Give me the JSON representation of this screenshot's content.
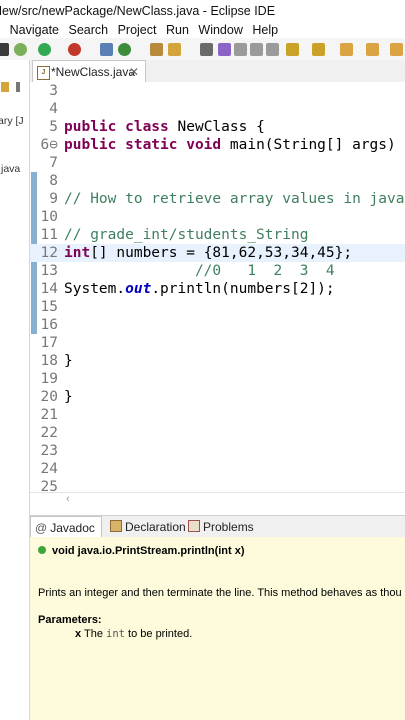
{
  "window": {
    "title": "New/src/newPackage/NewClass.java - Eclipse IDE"
  },
  "menu": {
    "items": [
      "r",
      "Navigate",
      "Search",
      "Project",
      "Run",
      "Window",
      "Help"
    ]
  },
  "left_panel": {
    "labels": [
      "ary [J",
      "java"
    ]
  },
  "editor": {
    "tab": {
      "label": "*NewClass.java",
      "icon": "J",
      "close": "✕"
    },
    "lines": [
      {
        "num": "3",
        "text": ""
      },
      {
        "num": "4",
        "text": ""
      },
      {
        "num": "5",
        "kw": "public class ",
        "text": "NewClass {"
      },
      {
        "num": "6⊖",
        "kw": "public static void ",
        "text": "main(String[] args) {"
      },
      {
        "num": "7",
        "text": ""
      },
      {
        "num": "8",
        "text": ""
      },
      {
        "num": "9",
        "comment": "// How to retrieve array values in java"
      },
      {
        "num": "10",
        "text": ""
      },
      {
        "num": "11",
        "comment": "// grade_int/students_String"
      },
      {
        "num": "12",
        "kw": "int",
        "text": "[] numbers = {81,62,53,34,45};"
      },
      {
        "num": "13",
        "comment": "               //0   1  2  3  4"
      },
      {
        "num": "14",
        "pre": "System.",
        "italic": "out",
        "post": ".println(numbers[2]);"
      },
      {
        "num": "15",
        "text": ""
      },
      {
        "num": "16",
        "text": ""
      },
      {
        "num": "17",
        "text": ""
      },
      {
        "num": "18",
        "text": "}"
      },
      {
        "num": "19",
        "text": ""
      },
      {
        "num": "20",
        "text": "}"
      },
      {
        "num": "21",
        "text": ""
      },
      {
        "num": "22",
        "text": ""
      },
      {
        "num": "23",
        "text": ""
      },
      {
        "num": "24",
        "text": ""
      },
      {
        "num": "25",
        "text": ""
      }
    ]
  },
  "bottom_panel": {
    "tabs": [
      "Javadoc",
      "Declaration",
      "Problems"
    ],
    "javadoc": {
      "signature": "void java.io.PrintStream.println(int x)",
      "description": "Prints an integer and then terminate the line. This method behaves as thou",
      "params_heading": "Parameters:",
      "param_name": "x",
      "param_pre": "The",
      "param_code": "int",
      "param_post": "to be printed."
    }
  },
  "colors": {
    "keyword": "#7f0055",
    "comment": "#3f7f5f",
    "static_field": "#0000c0",
    "javadoc_bg": "#fdfbdc",
    "current_line": "#e8f2fe"
  }
}
